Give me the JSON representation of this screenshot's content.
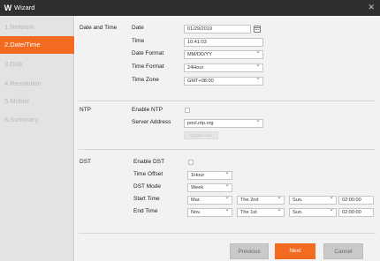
{
  "window": {
    "logo": "W",
    "title": "Wizard",
    "close": "✕"
  },
  "sidebar": {
    "items": [
      {
        "label": "1.Network"
      },
      {
        "label": "2.Date/Time"
      },
      {
        "label": "3.Disk"
      },
      {
        "label": "4.Resolution"
      },
      {
        "label": "5.Mobile"
      },
      {
        "label": "6.Summary"
      }
    ],
    "active_index": 1
  },
  "date_time": {
    "section_label": "Date and Time",
    "date_label": "Date",
    "date_value": "01/29/2019",
    "time_label": "Time",
    "time_value": "10:41:03",
    "date_format_label": "Date Format",
    "date_format_value": "MM/DD/YY",
    "time_format_label": "Time Format",
    "time_format_value": "24Hour",
    "time_zone_label": "Time Zone",
    "time_zone_value": "GMT+08:00"
  },
  "ntp": {
    "section_label": "NTP",
    "enable_label": "Enable NTP",
    "enabled": false,
    "server_label": "Server Address",
    "server_value": "pool.ntp.org",
    "update_button": "Update now"
  },
  "dst": {
    "section_label": "DST",
    "enable_label": "Enable DST",
    "enabled": false,
    "offset_label": "Time Offset",
    "offset_value": "1Hour",
    "mode_label": "DST Mode",
    "mode_value": "Week",
    "start_label": "Start Time",
    "start_month": "Mar.",
    "start_week": "The 2nd",
    "start_day": "Sun.",
    "start_time": "02:00:00",
    "end_label": "End Time",
    "end_month": "Nov.",
    "end_week": "The 1st",
    "end_day": "Sun.",
    "end_time": "02:00:00"
  },
  "footer": {
    "previous": "Previous",
    "next": "Next",
    "cancel": "Cancel"
  },
  "colors": {
    "accent": "#f36a21",
    "titlebar": "#2f2f2f",
    "sidebar": "#e3e3e3",
    "panel": "#f2f2f2"
  }
}
